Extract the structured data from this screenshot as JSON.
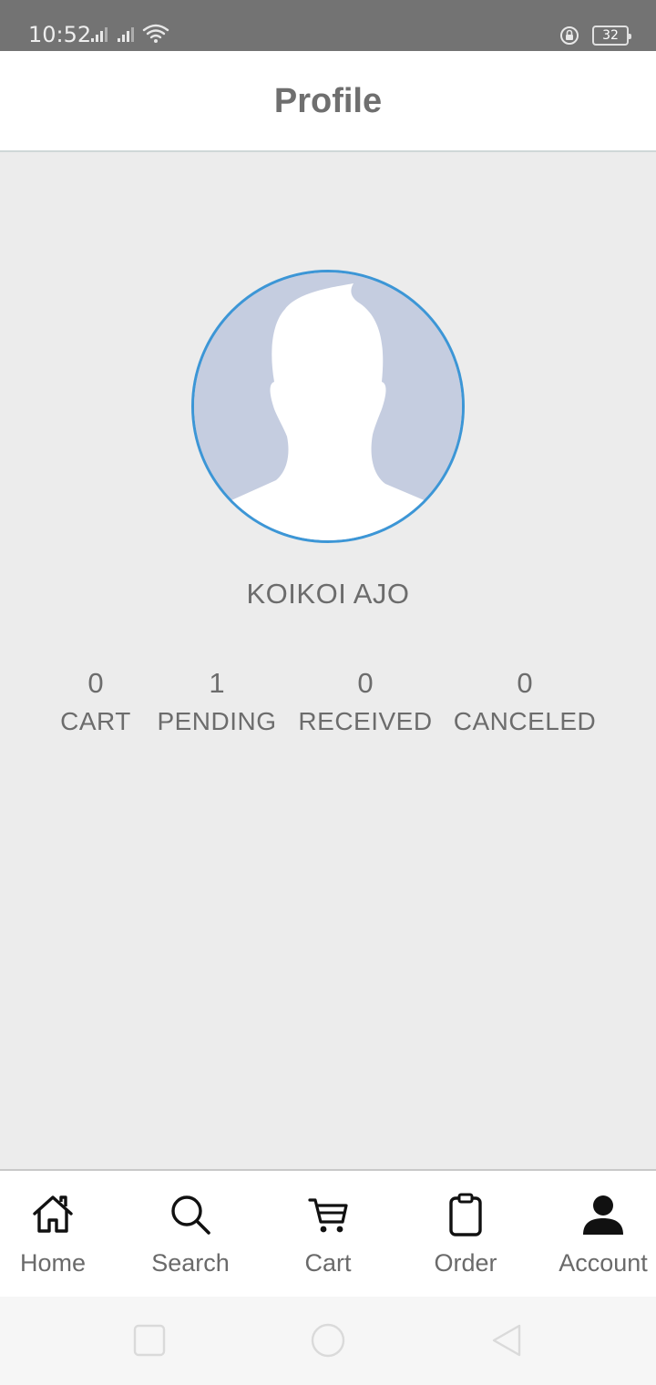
{
  "status_bar": {
    "time": "10:52",
    "battery": "32"
  },
  "header": {
    "title": "Profile"
  },
  "profile": {
    "name": "KOIKOI AJO",
    "avatar_icon": "default-user-silhouette",
    "avatar_ring_color": "#3c96d6"
  },
  "stats": [
    {
      "value": "0",
      "label": "CART"
    },
    {
      "value": "1",
      "label": "PENDING"
    },
    {
      "value": "0",
      "label": "RECEIVED"
    },
    {
      "value": "0",
      "label": "CANCELED"
    }
  ],
  "bottom_nav": [
    {
      "label": "Home",
      "icon": "home-icon"
    },
    {
      "label": "Search",
      "icon": "search-icon"
    },
    {
      "label": "Cart",
      "icon": "cart-icon"
    },
    {
      "label": "Order",
      "icon": "clipboard-icon"
    },
    {
      "label": "Account",
      "icon": "account-icon",
      "active": true
    }
  ]
}
